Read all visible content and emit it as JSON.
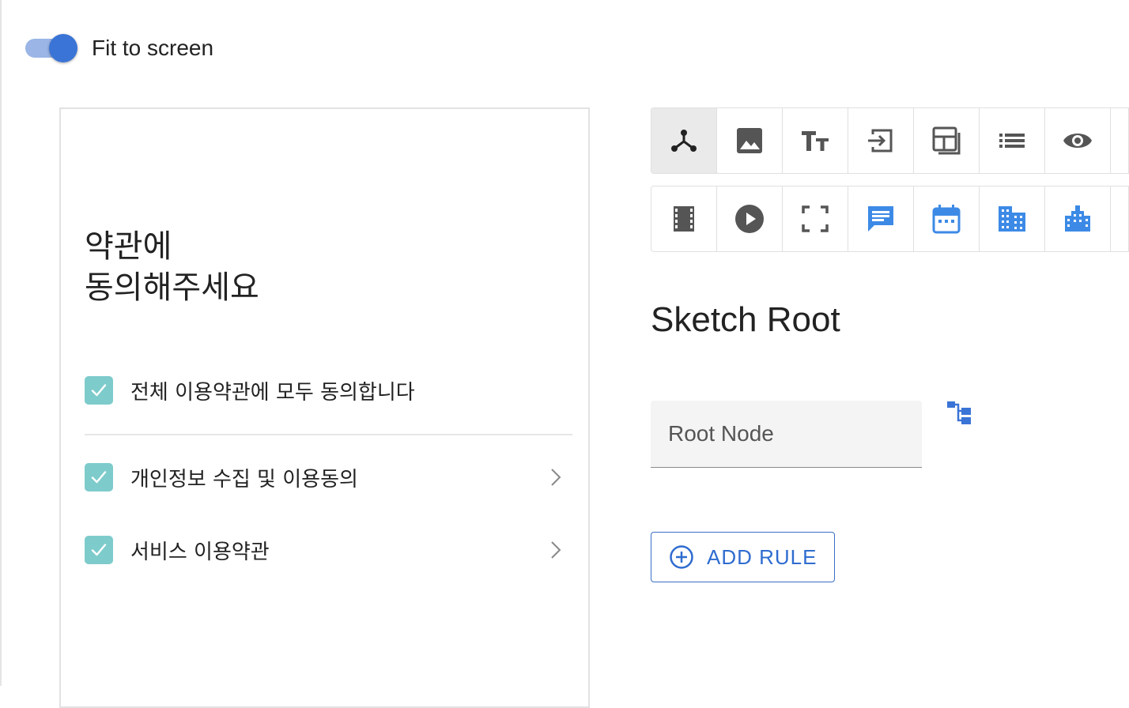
{
  "toggle": {
    "label": "Fit to screen",
    "on": true
  },
  "preview": {
    "title": "약관에\n동의해주세요",
    "agree_all": {
      "label": "전체 이용약관에 모두 동의합니다",
      "checked": true
    },
    "items": [
      {
        "label": "개인정보 수집 및 이용동의",
        "checked": true
      },
      {
        "label": "서비스 이용약관",
        "checked": true
      }
    ]
  },
  "toolbar": {
    "row1": [
      "root-node-icon",
      "image-icon",
      "text-icon",
      "input-icon",
      "layout-icon",
      "list-icon",
      "eye-icon"
    ],
    "row2": [
      "film-icon",
      "play-icon",
      "fullscreen-icon",
      "chat-icon",
      "calendar-icon",
      "building-icon",
      "city-icon"
    ],
    "selected": "root-node-icon"
  },
  "section": {
    "title": "Sketch Root"
  },
  "root_node": {
    "value": "Root Node"
  },
  "add_rule": {
    "label": "ADD RULE"
  },
  "colors": {
    "accent": "#3a74d6",
    "checkbox": "#7ecbcc",
    "icon_gray": "#555555",
    "icon_blue": "#3c8ae6"
  }
}
